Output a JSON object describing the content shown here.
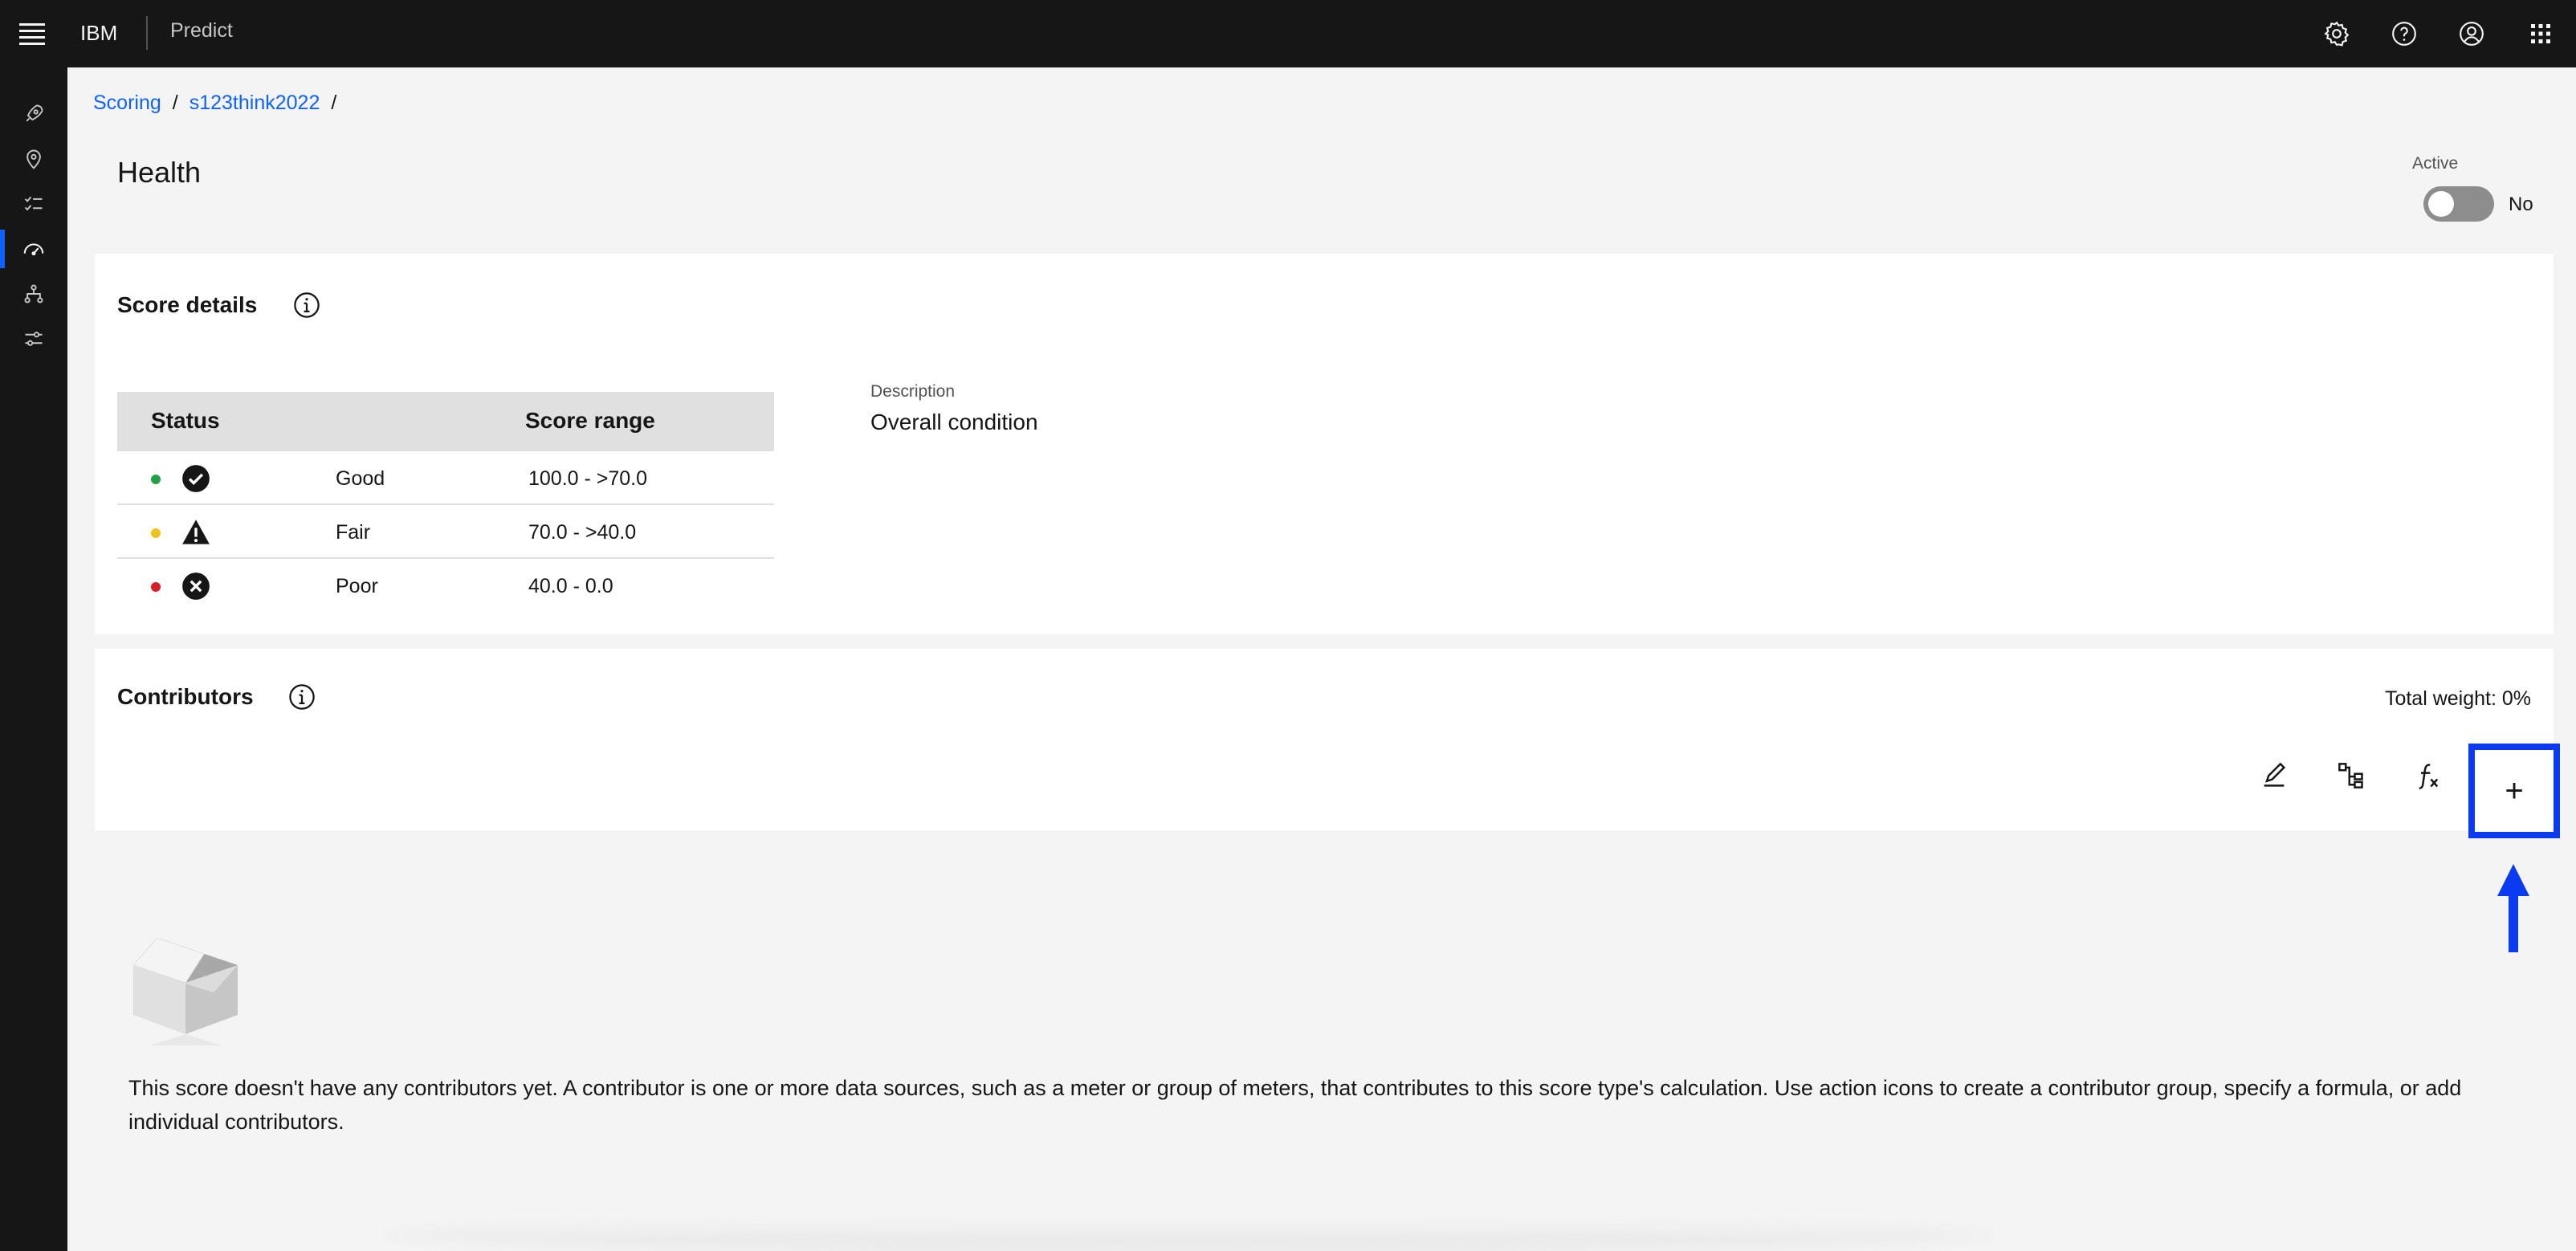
{
  "header": {
    "brand": "IBM",
    "product": "Predict"
  },
  "breadcrumb": {
    "items": [
      "Scoring",
      "s123think2022"
    ],
    "separator": "/"
  },
  "page": {
    "title": "Health",
    "active_label": "Active",
    "active_value": "No"
  },
  "score_details": {
    "title": "Score details",
    "table": {
      "headers": [
        "Status",
        "Score range"
      ],
      "rows": [
        {
          "status": "Good",
          "range": "100.0 - >70.0",
          "color": "#24a148",
          "icon": "checkmark-filled-icon"
        },
        {
          "status": "Fair",
          "range": "70.0 - >40.0",
          "color": "#f1c21b",
          "icon": "warning-filled-icon"
        },
        {
          "status": "Poor",
          "range": "40.0 - 0.0",
          "color": "#da1e28",
          "icon": "error-filled-icon"
        }
      ]
    },
    "description_label": "Description",
    "description_value": "Overall condition"
  },
  "contributors": {
    "title": "Contributors",
    "total_weight": "Total weight: 0%",
    "add_symbol": "+",
    "empty_message": "This score doesn't have any contributors yet. A contributor is one or more data sources, such as a meter or group of meters, that contributes to this score type's calculation. Use action icons to create a contributor group, specify a formula, or add individual contributors."
  },
  "colors": {
    "accent": "#0f62fe",
    "highlight": "#0a3bf0",
    "header_bg": "#161616"
  }
}
